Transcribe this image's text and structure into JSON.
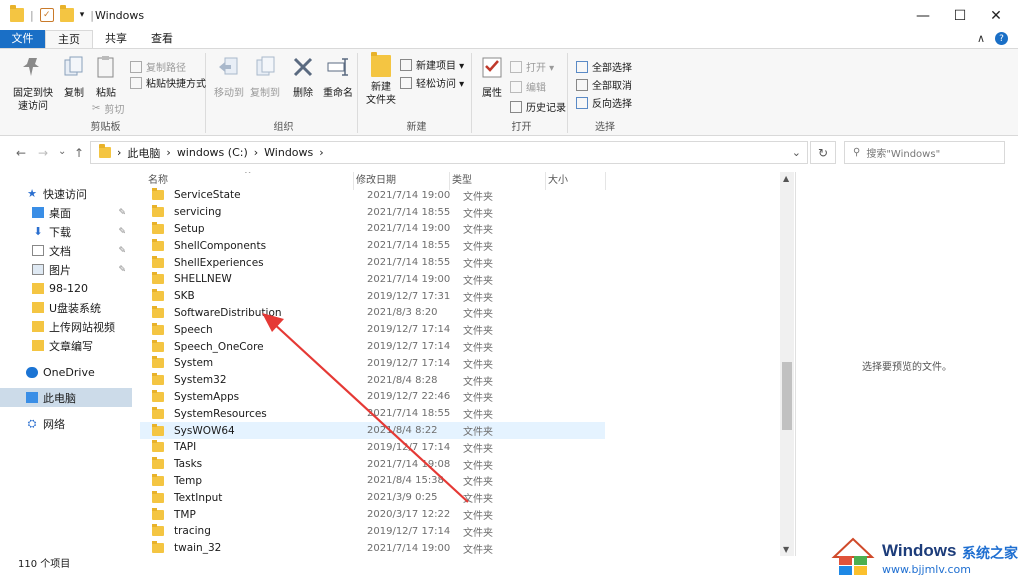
{
  "window": {
    "title": "Windows",
    "min_icon": "—",
    "max_icon": "☐",
    "close_icon": "✕"
  },
  "tabs": [
    {
      "label": "文件"
    },
    {
      "label": "主页"
    },
    {
      "label": "共享"
    },
    {
      "label": "查看"
    }
  ],
  "tabs_right": {
    "collapse": "∧",
    "help": "?"
  },
  "ribbon": {
    "clipboard": {
      "label": "剪贴板",
      "pin": "固定到快\n速访问",
      "copy": "复制",
      "paste": "粘贴",
      "copy_path": "复制路径",
      "paste_shortcut": "粘贴快捷方式",
      "cut": "剪切"
    },
    "organize": {
      "label": "组织",
      "move_to": "移动到",
      "copy_to": "复制到",
      "delete": "删除",
      "rename": "重命名"
    },
    "new": {
      "label": "新建",
      "new_folder": "新建\n文件夹",
      "new_item": "新建项目 ▾",
      "easy_access": "轻松访问 ▾"
    },
    "open": {
      "label": "打开",
      "properties": "属性",
      "open": "打开 ▾",
      "edit": "编辑",
      "history": "历史记录"
    },
    "select": {
      "label": "选择",
      "select_all": "全部选择",
      "select_none": "全部取消",
      "invert": "反向选择"
    }
  },
  "address": {
    "back": "←",
    "forward": "→",
    "recent": "⌄",
    "up": "↑",
    "crumbs": [
      "此电脑",
      "windows (C:)",
      "Windows"
    ],
    "sep": "›",
    "dropdown": "⌄",
    "refresh": "↻",
    "search_placeholder": "搜索\"Windows\"",
    "search_icon": "⚲"
  },
  "nav": [
    {
      "label": "快速访问",
      "icon": "star-icon"
    },
    {
      "label": "桌面",
      "icon": "desktop-icon",
      "pinned": true
    },
    {
      "label": "下载",
      "icon": "download-icon",
      "pinned": true
    },
    {
      "label": "文档",
      "icon": "document-icon",
      "pinned": true
    },
    {
      "label": "图片",
      "icon": "picture-icon",
      "pinned": true
    },
    {
      "label": "98-120",
      "icon": "folder-icon"
    },
    {
      "label": "U盘装系统",
      "icon": "folder-icon"
    },
    {
      "label": "上传网站视频",
      "icon": "folder-icon"
    },
    {
      "label": "文章编写",
      "icon": "folder-icon"
    },
    {
      "label": "OneDrive",
      "icon": "cloud-icon"
    },
    {
      "label": "此电脑",
      "icon": "computer-icon"
    },
    {
      "label": "网络",
      "icon": "network-icon"
    }
  ],
  "columns": {
    "name": "名称",
    "date": "修改日期",
    "type": "类型",
    "size": "大小",
    "sort": "^"
  },
  "files": [
    {
      "name": "ServiceState",
      "date": "2021/7/14 19:00",
      "type": "文件夹"
    },
    {
      "name": "servicing",
      "date": "2021/7/14 18:55",
      "type": "文件夹"
    },
    {
      "name": "Setup",
      "date": "2021/7/14 19:00",
      "type": "文件夹"
    },
    {
      "name": "ShellComponents",
      "date": "2021/7/14 18:55",
      "type": "文件夹"
    },
    {
      "name": "ShellExperiences",
      "date": "2021/7/14 18:55",
      "type": "文件夹"
    },
    {
      "name": "SHELLNEW",
      "date": "2021/7/14 19:00",
      "type": "文件夹"
    },
    {
      "name": "SKB",
      "date": "2019/12/7 17:31",
      "type": "文件夹"
    },
    {
      "name": "SoftwareDistribution",
      "date": "2021/8/3 8:20",
      "type": "文件夹"
    },
    {
      "name": "Speech",
      "date": "2019/12/7 17:14",
      "type": "文件夹"
    },
    {
      "name": "Speech_OneCore",
      "date": "2019/12/7 17:14",
      "type": "文件夹"
    },
    {
      "name": "System",
      "date": "2019/12/7 17:14",
      "type": "文件夹"
    },
    {
      "name": "System32",
      "date": "2021/8/4 8:28",
      "type": "文件夹"
    },
    {
      "name": "SystemApps",
      "date": "2019/12/7 22:46",
      "type": "文件夹"
    },
    {
      "name": "SystemResources",
      "date": "2021/7/14 18:55",
      "type": "文件夹"
    },
    {
      "name": "SysWOW64",
      "date": "2021/8/4 8:22",
      "type": "文件夹",
      "hover": true
    },
    {
      "name": "TAPI",
      "date": "2019/12/7 17:14",
      "type": "文件夹"
    },
    {
      "name": "Tasks",
      "date": "2021/7/14 19:08",
      "type": "文件夹"
    },
    {
      "name": "Temp",
      "date": "2021/8/4 15:38",
      "type": "文件夹"
    },
    {
      "name": "TextInput",
      "date": "2021/3/9 0:25",
      "type": "文件夹"
    },
    {
      "name": "TMP",
      "date": "2020/3/17 12:22",
      "type": "文件夹"
    },
    {
      "name": "tracing",
      "date": "2019/12/7 17:14",
      "type": "文件夹"
    },
    {
      "name": "twain_32",
      "date": "2021/7/14 19:00",
      "type": "文件夹"
    }
  ],
  "preview": {
    "text": "选择要预览的文件。"
  },
  "status": {
    "count": "110 个项目"
  },
  "watermark": {
    "brand": "Windows",
    "cn": "系统之家",
    "url": "www.bjjmlv.com"
  },
  "colors": {
    "accent": "#1a6fc6",
    "arrow": "#e53935",
    "folder": "#f4c542",
    "selected": "#ccdbe9",
    "hover": "#e5f3ff"
  }
}
